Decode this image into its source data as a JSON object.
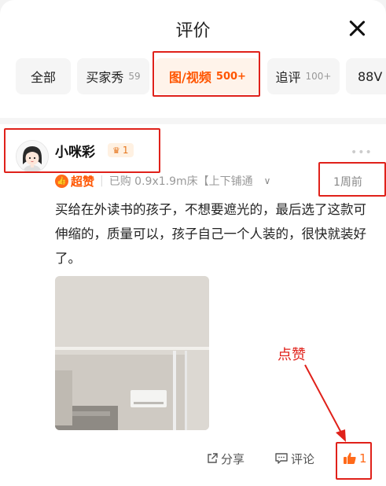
{
  "header": {
    "title": "评价"
  },
  "tabs": [
    {
      "label": "全部",
      "count": ""
    },
    {
      "label": "买家秀",
      "count": "59"
    },
    {
      "label": "图/视频",
      "count": "500+"
    },
    {
      "label": "追评",
      "count": "100+"
    },
    {
      "label": "88V",
      "count": ""
    }
  ],
  "review": {
    "username": "小咪彩",
    "vip_level": "1",
    "badge": "超赞",
    "purchase_info": "已购 0.9x1.9m床【上下铺通",
    "time": "1周前",
    "text": "买给在外读书的孩子，不想要遮光的，最后选了这款可伸缩的，质量可以，孩子自己一个人装的，很快就装好了。",
    "share_label": "分享",
    "comment_label": "评论",
    "like_count": "1"
  },
  "annotation": {
    "label": "点赞"
  },
  "colors": {
    "accent": "#ff5500",
    "annotation_red": "#e0211a"
  }
}
